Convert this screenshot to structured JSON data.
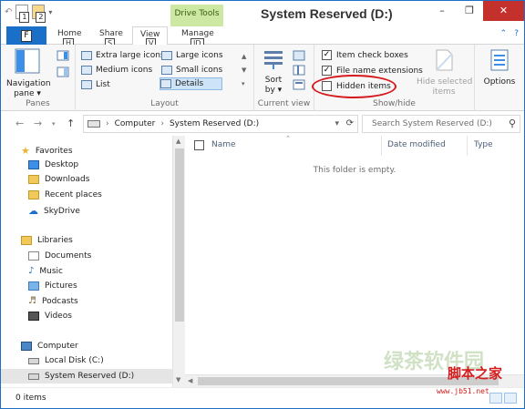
{
  "window": {
    "title": "System Reserved (D:)",
    "contextual_tab": "Drive Tools",
    "controls": {
      "minimize": "–",
      "maximize": "❐",
      "close": "✕"
    }
  },
  "quick_access": {
    "keytip1": "1",
    "keytip2": "2"
  },
  "tabs": {
    "file": {
      "label": "F",
      "keytip": "F"
    },
    "home": {
      "label": "Home",
      "keytip": "H"
    },
    "share": {
      "label": "Share",
      "keytip": "S"
    },
    "view": {
      "label": "View",
      "keytip": "V"
    },
    "manage": {
      "label": "Manage",
      "keytip": "JD"
    }
  },
  "ribbon": {
    "panes": {
      "label": "Panes",
      "navigation_pane": "Navigation\npane ▾"
    },
    "layout": {
      "label": "Layout",
      "items": [
        {
          "label": "Extra large icons"
        },
        {
          "label": "Large icons"
        },
        {
          "label": "Medium icons"
        },
        {
          "label": "Small icons"
        },
        {
          "label": "List"
        },
        {
          "label": "Details"
        }
      ]
    },
    "current_view": {
      "label": "Current view",
      "sort_by": "Sort\nby ▾"
    },
    "show_hide": {
      "label": "Show/hide",
      "item_check_boxes": "Item check boxes",
      "file_name_extensions": "File name extensions",
      "hidden_items": "Hidden items",
      "hide_selected_items": "Hide selected\nitems",
      "item_check_boxes_checked": true,
      "file_name_extensions_checked": true,
      "hidden_items_checked": false
    },
    "options": {
      "label": "Options"
    }
  },
  "address": {
    "path_root": "Computer",
    "path_leaf": "System Reserved (D:)",
    "search_placeholder": "Search System Reserved (D:)"
  },
  "nav": {
    "favorites": "Favorites",
    "desktop": "Desktop",
    "downloads": "Downloads",
    "recent_places": "Recent places",
    "skydrive": "SkyDrive",
    "libraries": "Libraries",
    "documents": "Documents",
    "music": "Music",
    "pictures": "Pictures",
    "podcasts": "Podcasts",
    "videos": "Videos",
    "computer": "Computer",
    "local_disk": "Local Disk (C:)",
    "system_reserved": "System Reserved (D:)"
  },
  "content": {
    "columns": {
      "name": "Name",
      "date_modified": "Date modified",
      "type": "Type"
    },
    "empty_message": "This folder is empty."
  },
  "status": {
    "item_count": "0 items"
  },
  "watermark": {
    "text": "脚本之家",
    "url": "www.jb51.net",
    "brand": "绿茶软件园"
  },
  "colors": {
    "accent": "#1a6fc9",
    "drive_tools": "#cde8a2",
    "highlight_circle": "#d6191c",
    "close": "#c4302b"
  }
}
